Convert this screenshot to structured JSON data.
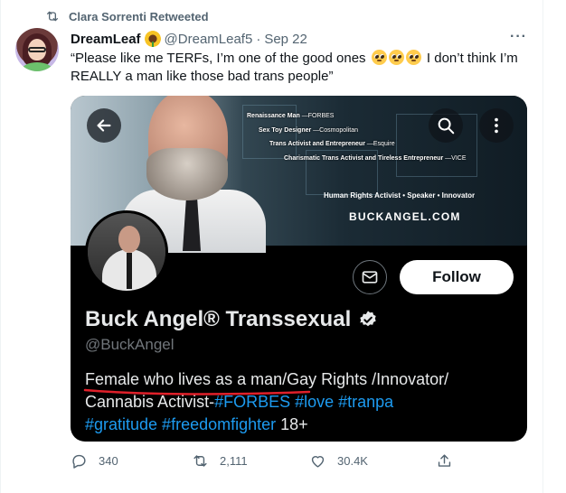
{
  "retweet": {
    "label": "Clara Sorrenti Retweeted"
  },
  "tweet": {
    "author_name": "DreamLeaf",
    "author_handle": "@DreamLeaf5",
    "separator": "·",
    "date": "Sep 22",
    "more_label": "···",
    "text_part1": "“Please like me TERFs, I’m one of the good ones",
    "text_part2": "I don’t think I’m REALLY a man like those bad trans people”"
  },
  "media": {
    "banner_captions": [
      {
        "bold": "Renaissance Man",
        "rest": " —FORBES"
      },
      {
        "bold": "Sex Toy Designer",
        "rest": " —Cosmopolitan"
      },
      {
        "bold": "Trans Activist and Entrepreneur",
        "rest": " —Esquire"
      },
      {
        "bold": "Charismatic Trans Activist and Tireless Entrepreneur",
        "rest": " —VICE"
      }
    ],
    "banner_tagline": "Human Rights Activist • Speaker • Innovator",
    "banner_site": "BUCKANGEL.COM",
    "follow_label": "Follow",
    "profile_name": "Buck Angel® Transsexual",
    "profile_handle": "@BuckAngel",
    "bio_line1": "Female who lives as a man/Gay Rights /Innovator/",
    "bio_line2_text": "Cannabis Activist-",
    "bio_line2_tags": "#FORBES #love #tranpa",
    "bio_line3_tags": "#gratitude #freedomfighter",
    "bio_line3_text": " 18+",
    "underline_color": "#e0202a"
  },
  "actions": {
    "replies": "340",
    "retweets": "2,111",
    "likes": "30.4K"
  },
  "icons": {
    "retweet": "retweet-icon",
    "reply": "reply-icon",
    "like": "heart-icon",
    "share": "share-icon",
    "back": "back-arrow-icon",
    "search": "search-icon",
    "more": "more-vertical-icon",
    "message": "envelope-icon",
    "verified": "verified-badge-icon"
  },
  "colors": {
    "accent": "#1d9bf0",
    "muted": "#536471"
  }
}
